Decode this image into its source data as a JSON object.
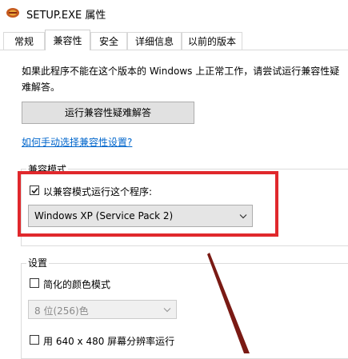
{
  "window": {
    "title": "SETUP.EXE 属性"
  },
  "tabs": [
    {
      "label": "常规"
    },
    {
      "label": "兼容性"
    },
    {
      "label": "安全"
    },
    {
      "label": "详细信息"
    },
    {
      "label": "以前的版本"
    }
  ],
  "active_tab": "兼容性",
  "compat": {
    "description": "如果此程序不能在这个版本的 Windows 上正常工作，请尝试运行兼容性疑难解答。",
    "troubleshoot_button": "运行兼容性疑难解答",
    "manual_link": "如何手动选择兼容性设置?"
  },
  "compat_mode": {
    "group_label": "兼容模式",
    "checkbox_label": "以兼容模式运行这个程序:",
    "checked": true,
    "selected_os": "Windows XP (Service Pack 2)"
  },
  "settings": {
    "group_label": "设置",
    "reduced_color_label": "简化的颜色模式",
    "reduced_color_checked": false,
    "color_select_value": "8 位(256)色",
    "resolution_label": "用 640 x 480 屏幕分辨率运行",
    "resolution_checked": false
  },
  "colors": {
    "highlight": "#e0282c",
    "link": "#0066cc",
    "annotation_arrow": "#7a1a14"
  }
}
